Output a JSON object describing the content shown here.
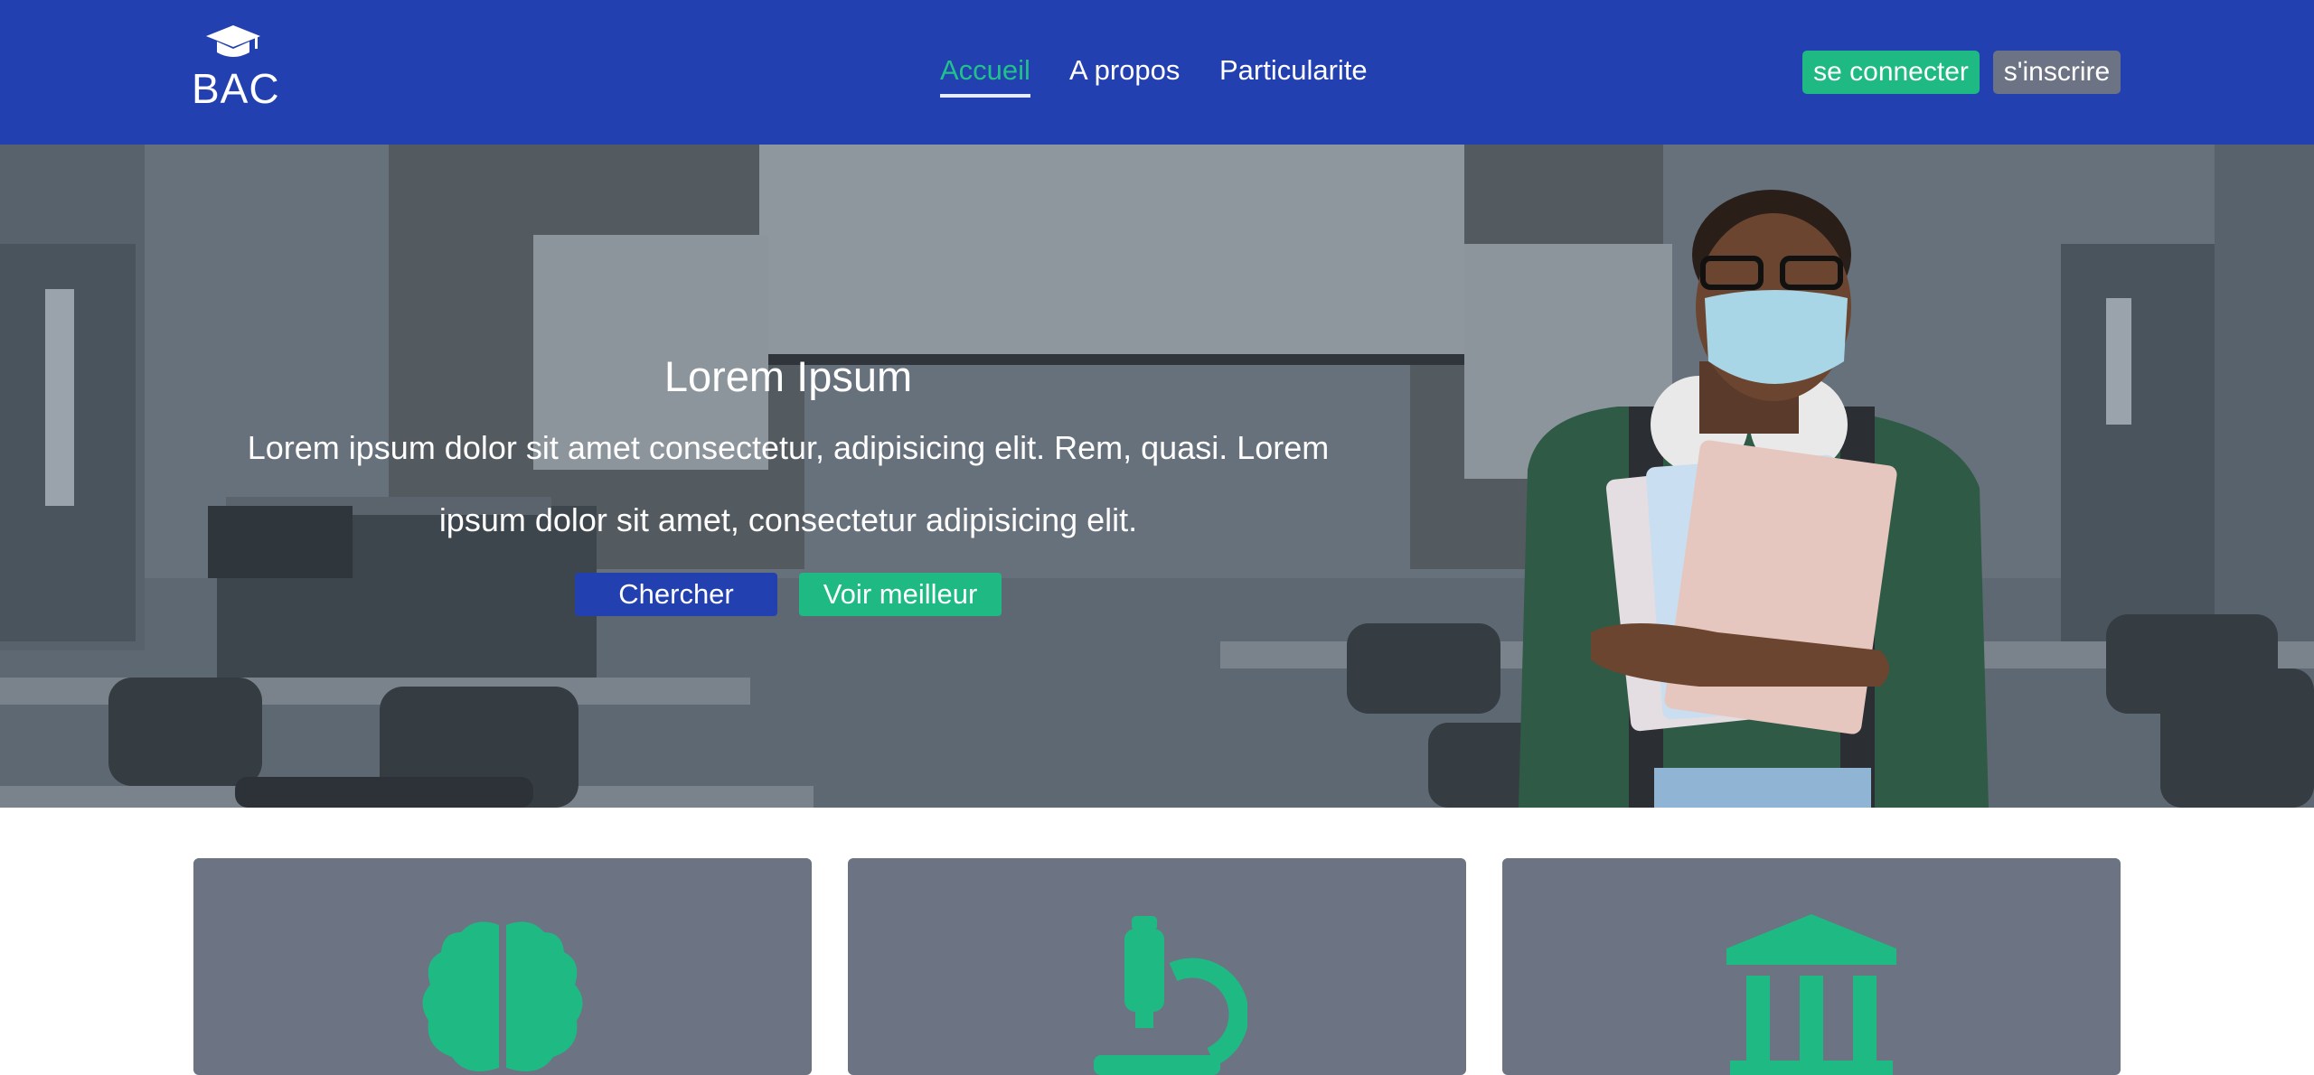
{
  "brand": {
    "name": "BAC",
    "icon": "graduation-cap-icon"
  },
  "nav": {
    "links": [
      {
        "label": "Accueil",
        "active": true
      },
      {
        "label": "A propos",
        "active": false
      },
      {
        "label": "Particularite",
        "active": false
      }
    ],
    "login_label": "se connecter",
    "signup_label": "s'inscrire"
  },
  "hero": {
    "title": "Lorem Ipsum",
    "text_line1": "Lorem ipsum dolor sit amet consectetur, adipisicing elit. Rem, quasi. Lorem",
    "text_line2": "ipsum dolor sit amet, consectetur adipisicing elit.",
    "search_label": "Chercher",
    "best_label": "Voir meilleur"
  },
  "cards": [
    {
      "icon": "brain-icon"
    },
    {
      "icon": "microscope-icon"
    },
    {
      "icon": "institution-icon"
    }
  ],
  "colors": {
    "primary": "#2340b0",
    "accent": "#1fba84",
    "secondary": "#6c7384"
  }
}
